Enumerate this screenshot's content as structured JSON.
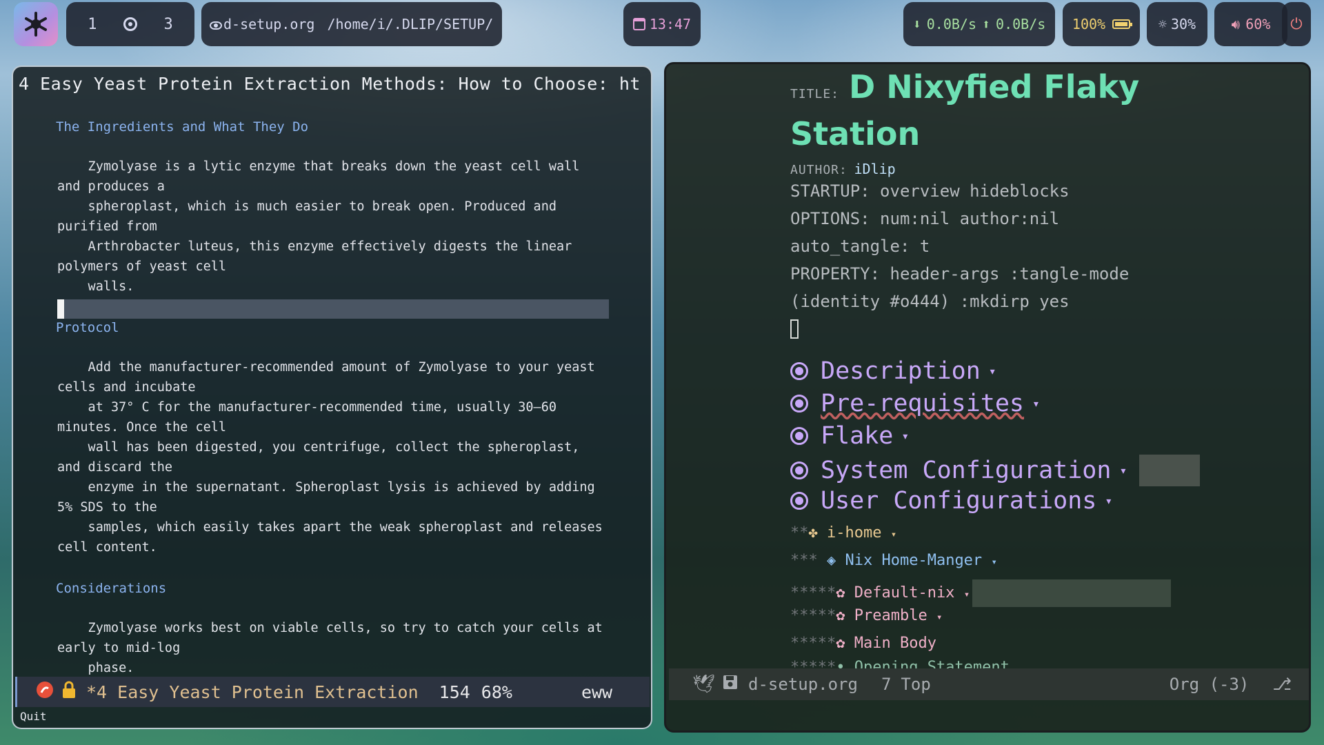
{
  "topbar": {
    "workspaces": [
      "1",
      "3"
    ],
    "window_file": "d-setup.org",
    "window_path": "/home/i/.DLIP/SETUP/",
    "clock": "13:47",
    "net_down": "0.0B/s",
    "net_up": "0.0B/s",
    "battery": "100%",
    "brightness": "30%",
    "volume": "60%"
  },
  "left_window": {
    "title": "4 Easy Yeast Protein Extraction Methods: How to Choose: ht",
    "heading_1": "The Ingredients and What They Do",
    "para_1": [
      "    Zymolyase is a lytic enzyme that breaks down the yeast cell wall",
      "and produces a",
      "    spheroplast, which is much easier to break open. Produced and",
      "purified from",
      "    Arthrobacter luteus, this enzyme effectively digests the linear",
      "polymers of yeast cell",
      "    walls."
    ],
    "heading_2": "Protocol",
    "para_2": [
      "    Add the manufacturer-recommended amount of Zymolyase to your yeast",
      "cells and incubate",
      "    at 37° C for the manufacturer-recommended time, usually 30–60",
      "minutes. Once the cell",
      "    wall has been digested, you centrifuge, collect the spheroplast,",
      "and discard the",
      "    enzyme in the supernatant. Spheroplast lysis is achieved by adding",
      "5% SDS to the",
      "    samples, which easily takes apart the weak spheroplast and releases",
      "cell content."
    ],
    "heading_3": "Considerations",
    "para_3": [
      "    Zymolyase works best on viable cells, so try to catch your cells at",
      "early to mid-log",
      "    phase."
    ],
    "modeline": {
      "buffer": "*4 Easy Yeast Protein Extraction",
      "line": "154",
      "percent": "68%",
      "mode": "eww"
    },
    "echo": "Quit"
  },
  "right_window": {
    "title_keyword": "TITLE:",
    "title_line1": "D Nixyfied Flaky",
    "title_line2": "Station",
    "author_keyword": "AUTHOR:",
    "author": "iDlip",
    "startup": "STARTUP: overview hideblocks",
    "options": "OPTIONS: num:nil author:nil",
    "auto_tangle": "auto_tangle: t",
    "property_1": "PROPERTY: header-args :tangle-mode",
    "property_2": "(identity #o444) :mkdirp yes",
    "headings": [
      "Description",
      "Pre-requisites",
      "Flake",
      "System Configuration",
      "User Configurations"
    ],
    "sub_i_home": "i-home",
    "sub_nix_home": "Nix Home-Manger",
    "sub_items": [
      "Default-nix",
      "Preamble",
      "Main Body"
    ],
    "sub_hidden": "Opening Statement",
    "stars_2": "**",
    "stars_3": "***",
    "stars_4": "*****",
    "modeline": {
      "file": "d-setup.org",
      "line": "7",
      "position": "Top",
      "mode": "Org (-3)"
    }
  },
  "colors": {
    "accent_heading": "#8cb4f0",
    "org_title": "#6ee0b4",
    "org_heading": "#c8a8f8",
    "modeline_buffer": "#e0c090"
  }
}
